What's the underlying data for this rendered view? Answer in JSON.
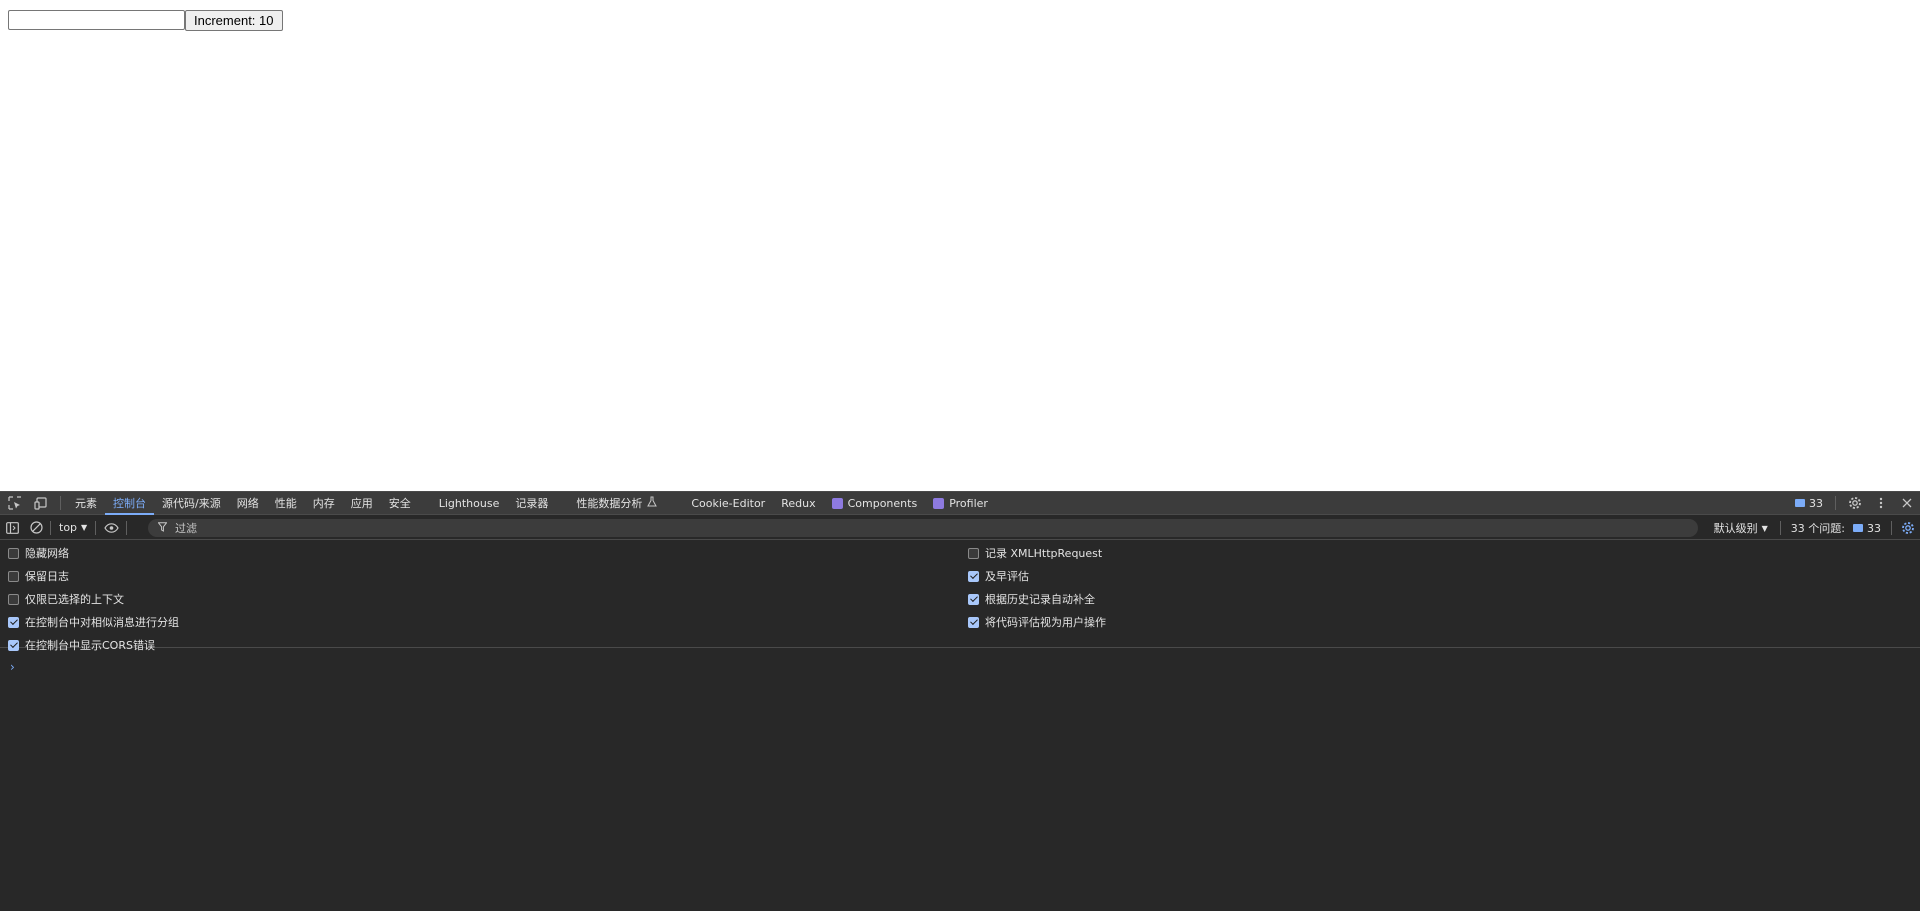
{
  "page": {
    "input_value": "",
    "button_label": "Increment: 10"
  },
  "devtools": {
    "tabs": [
      {
        "label": "元素",
        "active": false
      },
      {
        "label": "控制台",
        "active": true
      },
      {
        "label": "源代码/来源",
        "active": false
      },
      {
        "label": "网络",
        "active": false
      },
      {
        "label": "性能",
        "active": false
      },
      {
        "label": "内存",
        "active": false
      },
      {
        "label": "应用",
        "active": false
      },
      {
        "label": "安全",
        "active": false
      },
      {
        "label": "Lighthouse",
        "active": false
      },
      {
        "label": "记录器",
        "active": false
      },
      {
        "label": "性能数据分析",
        "active": false
      },
      {
        "label": "Cookie-Editor",
        "active": false
      },
      {
        "label": "Redux",
        "active": false
      },
      {
        "label": "Components",
        "active": false
      },
      {
        "label": "Profiler",
        "active": false
      }
    ],
    "issues_count": "33",
    "toolbar": {
      "context": "top",
      "filter_placeholder": "过滤",
      "level": "默认级别",
      "issues_label": "33 个问题:",
      "issues_count": "33"
    },
    "settings_left": [
      {
        "label": "隐藏网络",
        "checked": false
      },
      {
        "label": "保留日志",
        "checked": false
      },
      {
        "label": "仅限已选择的上下文",
        "checked": false
      },
      {
        "label": "在控制台中对相似消息进行分组",
        "checked": true
      },
      {
        "label": "在控制台中显示CORS错误",
        "checked": true
      }
    ],
    "settings_right": [
      {
        "label": "记录 XMLHttpRequest",
        "checked": false
      },
      {
        "label": "及早评估",
        "checked": true
      },
      {
        "label": "根据历史记录自动补全",
        "checked": true
      },
      {
        "label": "将代码评估视为用户操作",
        "checked": true
      }
    ],
    "prompt_symbol": "›",
    "colors": {
      "panel_bg": "#282828",
      "tabbar_bg": "#3c3c3c",
      "accent": "#7cacf8"
    }
  }
}
